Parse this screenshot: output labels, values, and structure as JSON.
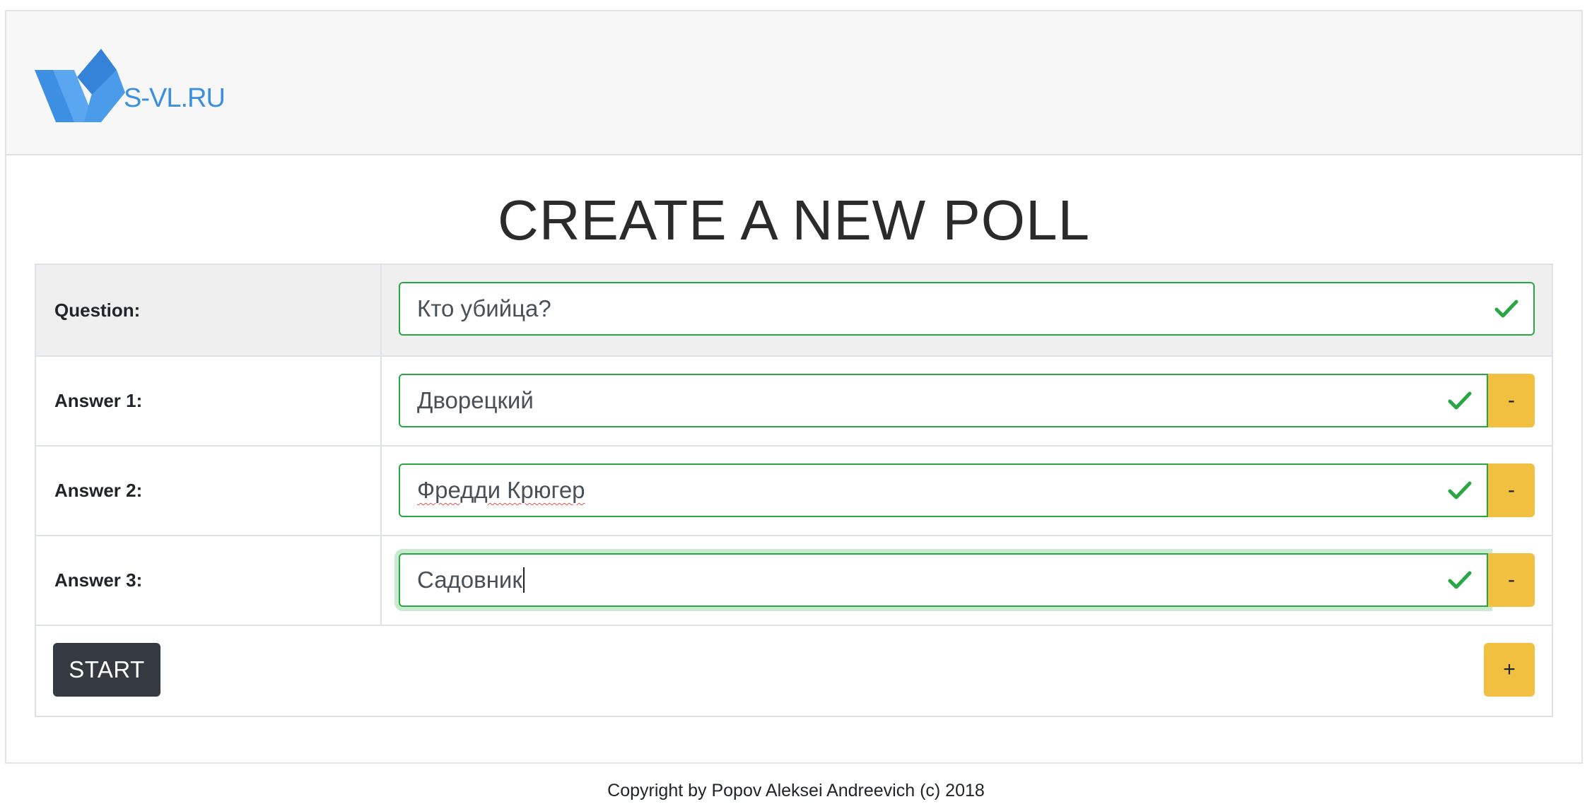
{
  "header": {
    "logo_text": "S-VL.RU",
    "logo_icon": "svl-logo-icon"
  },
  "page": {
    "title": "CREATE A NEW POLL"
  },
  "form": {
    "question_label": "Question:",
    "question_value": "Кто убийца?",
    "answers": [
      {
        "label": "Answer 1:",
        "value": "Дворецкий",
        "remove_label": "-"
      },
      {
        "label": "Answer 2:",
        "value": "Фредди Крюгер",
        "remove_label": "-"
      },
      {
        "label": "Answer 3:",
        "value": "Садовник",
        "remove_label": "-"
      }
    ],
    "start_label": "START",
    "add_label": "+"
  },
  "footer": {
    "copyright": "Copyright by Popov Aleksei Andreevich (c) 2018"
  },
  "colors": {
    "valid_green": "#28a745",
    "warning_yellow": "#f2c040",
    "dark_button": "#343a40",
    "logo_blue": "#3b8fe0"
  },
  "icons": {
    "valid": "check-icon"
  }
}
